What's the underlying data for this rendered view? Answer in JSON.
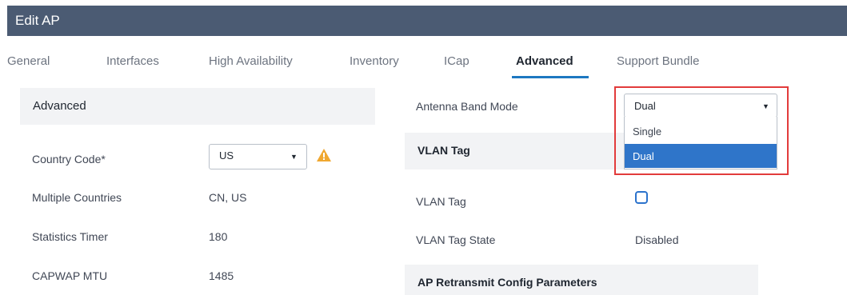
{
  "window": {
    "title": "Edit AP"
  },
  "tabs": [
    {
      "label": "General"
    },
    {
      "label": "Interfaces"
    },
    {
      "label": "High Availability"
    },
    {
      "label": "Inventory"
    },
    {
      "label": "ICap"
    },
    {
      "label": "Advanced"
    },
    {
      "label": "Support Bundle"
    }
  ],
  "active_tab": "Advanced",
  "left": {
    "section_title": "Advanced",
    "country_code": {
      "label": "Country Code*",
      "value": "US"
    },
    "multiple_countries": {
      "label": "Multiple Countries",
      "value": "CN, US"
    },
    "statistics_timer": {
      "label": "Statistics Timer",
      "value": "180"
    },
    "capwap_mtu": {
      "label": "CAPWAP MTU",
      "value": "1485"
    }
  },
  "right": {
    "antenna_band_mode": {
      "label": "Antenna Band Mode",
      "value": "Dual",
      "options": [
        "Single",
        "Dual"
      ]
    },
    "vlan_section_title": "VLAN Tag",
    "vlan_tag": {
      "label": "VLAN Tag",
      "checked": false
    },
    "vlan_tag_state": {
      "label": "VLAN Tag State",
      "value": "Disabled"
    },
    "retransmit_section_title": "AP Retransmit Config Parameters"
  },
  "colors": {
    "titlebar": "#4b5b73",
    "active_tab_underline": "#1d78c1",
    "highlight_border": "#e23b3b",
    "selected_option": "#2f75c9",
    "warning": "#f0a830"
  },
  "icons": {
    "warning": "warning-triangle-icon",
    "caret": "caret-down-icon"
  }
}
